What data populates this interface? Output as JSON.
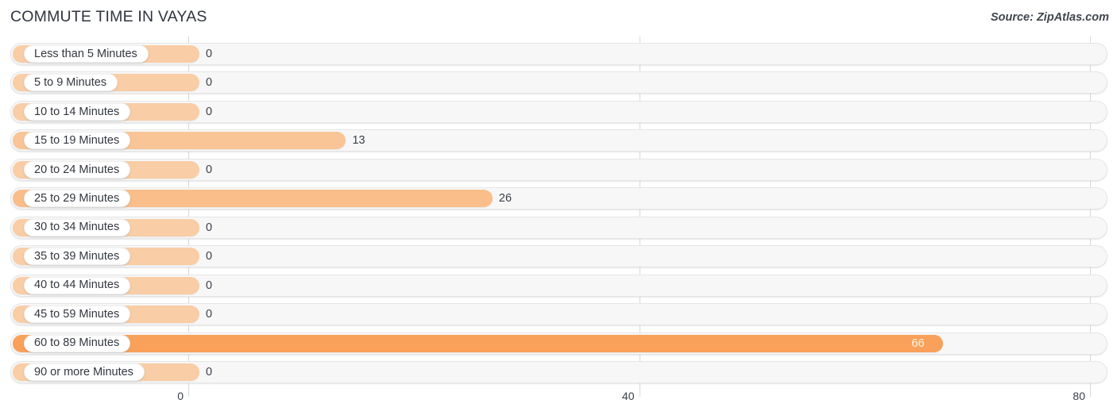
{
  "header": {
    "title": "COMMUTE TIME IN VAYAS",
    "source": "Source: ZipAtlas.com"
  },
  "colors": {
    "bar_light": "#f9cda5",
    "bar_mid": "#f9c596",
    "bar_strong": "#f9a15a",
    "track_bg": "#f7f7f7",
    "track_border": "#e6e6e6",
    "gridline": "#d8d8d8",
    "text": "#33373e",
    "value_inside": "#fdf4e8"
  },
  "axis": {
    "ticks": [
      {
        "label": "0",
        "value": 0
      },
      {
        "label": "40",
        "value": 40
      },
      {
        "label": "80",
        "value": 80
      }
    ],
    "min": 0,
    "max": 80
  },
  "chart_data": {
    "type": "bar",
    "orientation": "horizontal",
    "title": "COMMUTE TIME IN VAYAS",
    "subtitle": "",
    "xlabel": "",
    "ylabel": "",
    "xlim": [
      0,
      80
    ],
    "grid": true,
    "legend": "none",
    "source": "Source: ZipAtlas.com",
    "categories": [
      "Less than 5 Minutes",
      "5 to 9 Minutes",
      "10 to 14 Minutes",
      "15 to 19 Minutes",
      "20 to 24 Minutes",
      "25 to 29 Minutes",
      "30 to 34 Minutes",
      "35 to 39 Minutes",
      "40 to 44 Minutes",
      "45 to 59 Minutes",
      "60 to 89 Minutes",
      "90 or more Minutes"
    ],
    "values": [
      0,
      0,
      0,
      13,
      0,
      26,
      0,
      0,
      0,
      0,
      66,
      0
    ],
    "value_labels": [
      "0",
      "0",
      "0",
      "13",
      "0",
      "26",
      "0",
      "0",
      "0",
      "0",
      "66",
      "0"
    ]
  },
  "rows": [
    {
      "label": "Less than 5 Minutes",
      "value": 0,
      "value_label": "0",
      "color": "#f9cda5",
      "label_inside": false
    },
    {
      "label": "5 to 9 Minutes",
      "value": 0,
      "value_label": "0",
      "color": "#f9cda5",
      "label_inside": false
    },
    {
      "label": "10 to 14 Minutes",
      "value": 0,
      "value_label": "0",
      "color": "#f9cda5",
      "label_inside": false
    },
    {
      "label": "15 to 19 Minutes",
      "value": 13,
      "value_label": "13",
      "color": "#f9c596",
      "label_inside": false
    },
    {
      "label": "20 to 24 Minutes",
      "value": 0,
      "value_label": "0",
      "color": "#f9cda5",
      "label_inside": false
    },
    {
      "label": "25 to 29 Minutes",
      "value": 26,
      "value_label": "26",
      "color": "#f9be8a",
      "label_inside": false
    },
    {
      "label": "30 to 34 Minutes",
      "value": 0,
      "value_label": "0",
      "color": "#f9cda5",
      "label_inside": false
    },
    {
      "label": "35 to 39 Minutes",
      "value": 0,
      "value_label": "0",
      "color": "#f9cda5",
      "label_inside": false
    },
    {
      "label": "40 to 44 Minutes",
      "value": 0,
      "value_label": "0",
      "color": "#f9cda5",
      "label_inside": false
    },
    {
      "label": "45 to 59 Minutes",
      "value": 0,
      "value_label": "0",
      "color": "#f9cda5",
      "label_inside": false
    },
    {
      "label": "60 to 89 Minutes",
      "value": 66,
      "value_label": "66",
      "color": "#f9a15a",
      "label_inside": true
    },
    {
      "label": "90 or more Minutes",
      "value": 0,
      "value_label": "0",
      "color": "#f9cda5",
      "label_inside": false
    }
  ]
}
